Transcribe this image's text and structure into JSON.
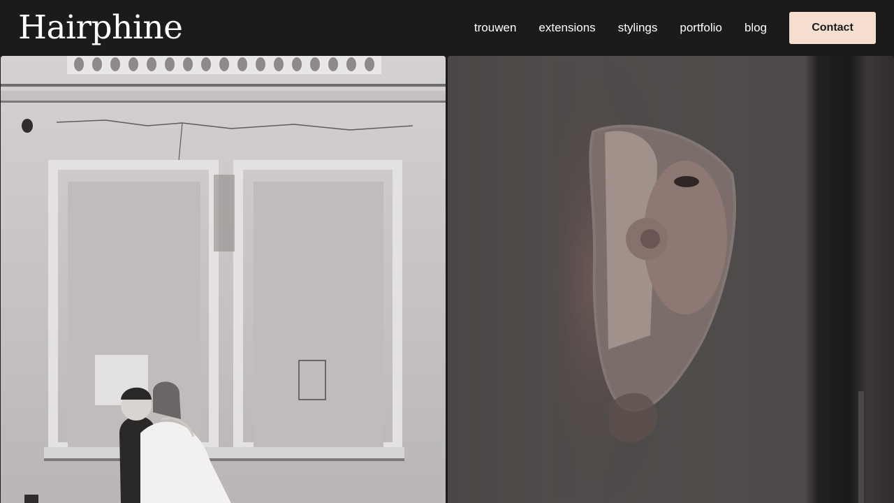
{
  "brand": {
    "name": "Hairphine"
  },
  "nav": {
    "items": [
      {
        "label": "trouwen"
      },
      {
        "label": "extensions"
      },
      {
        "label": "stylings"
      },
      {
        "label": "portfolio"
      },
      {
        "label": "blog"
      }
    ],
    "cta_label": "Contact"
  },
  "colors": {
    "header_bg": "#1b1b1b",
    "cta_bg": "#f6dfd0",
    "text": "#ffffff"
  },
  "gallery": {
    "images": [
      {
        "subject": "wedding-couple-photo"
      },
      {
        "subject": "mirror-makeup-photo"
      }
    ]
  }
}
